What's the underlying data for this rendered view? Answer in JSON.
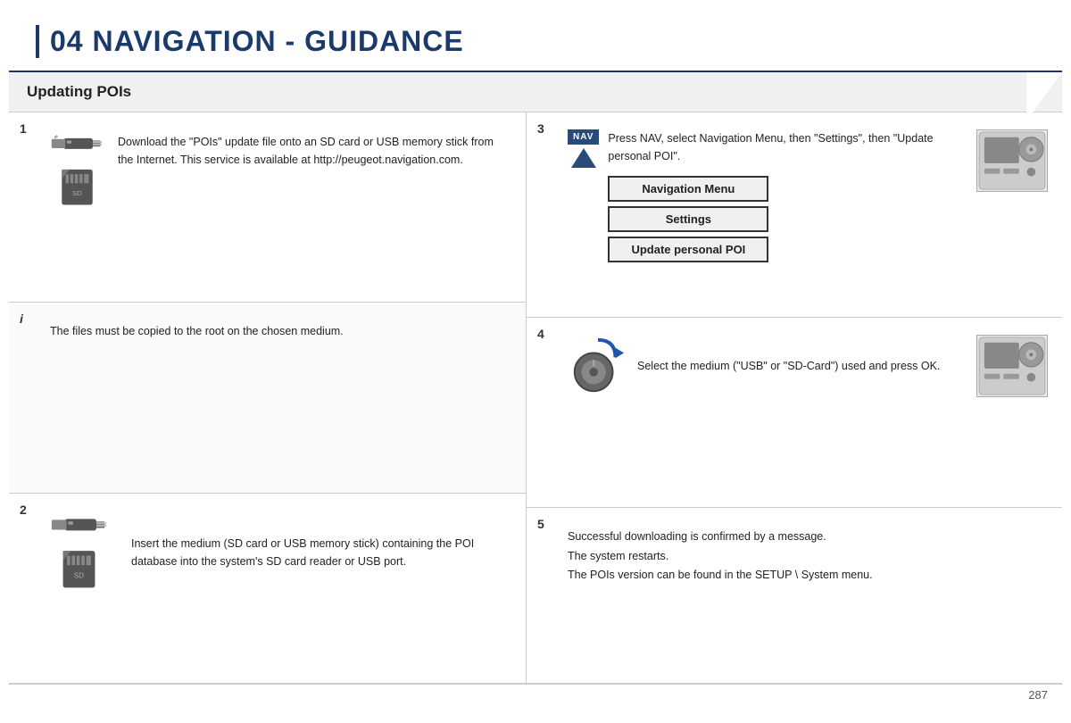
{
  "header": {
    "title": "04  NAVIGATION - GUIDANCE"
  },
  "sub_header": {
    "title": "Updating POIs"
  },
  "steps": {
    "step1": {
      "number": "1",
      "text": "Download the \"POIs\" update file onto an SD card or USB memory stick from the Internet. This service is available at http://peugeot.navigation.com."
    },
    "info": {
      "symbol": "i",
      "text": "The files must be copied to the root on the chosen medium."
    },
    "step2": {
      "number": "2",
      "text": "Insert the medium (SD card or USB memory stick) containing the POI database into the system's SD card reader or USB port."
    },
    "step3": {
      "number": "3",
      "text": "Press NAV, select Navigation Menu, then \"Settings\", then \"Update personal POI\".",
      "nav_label": "NAV",
      "btn1": "Navigation Menu",
      "btn2": "Settings",
      "btn3": "Update personal POI"
    },
    "step4": {
      "number": "4",
      "text": "Select the medium (\"USB\" or \"SD-Card\") used and press OK."
    },
    "step5": {
      "number": "5",
      "text_line1": "Successful downloading is confirmed by a message.",
      "text_line2": "The system restarts.",
      "text_line3": "The POIs version can be found in the SETUP \\ System menu."
    }
  },
  "footer": {
    "page_number": "287"
  }
}
